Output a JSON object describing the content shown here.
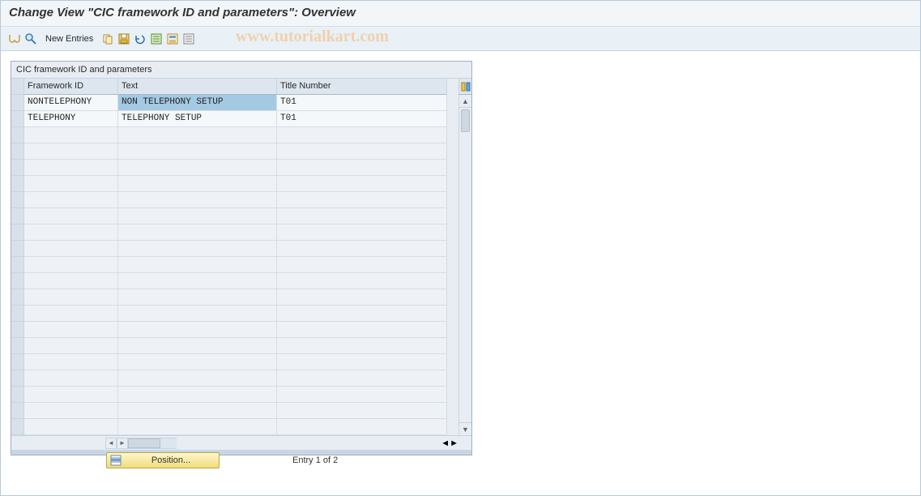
{
  "title": "Change View \"CIC framework ID and parameters\": Overview",
  "toolbar": {
    "new_entries": "New Entries"
  },
  "watermark": "www.tutorialkart.com",
  "table": {
    "caption": "CIC framework ID and parameters",
    "columns": [
      "Framework ID",
      "Text",
      "Title Number"
    ],
    "rows": [
      {
        "id": "NONTELEPHONY",
        "text": "NON TELEPHONY SETUP",
        "title": "T01",
        "text_selected": true
      },
      {
        "id": "TELEPHONY",
        "text": "TELEPHONY SETUP",
        "title": "T01",
        "text_selected": false
      }
    ]
  },
  "footer": {
    "position_label": "Position...",
    "entry_text": "Entry 1 of 2"
  }
}
